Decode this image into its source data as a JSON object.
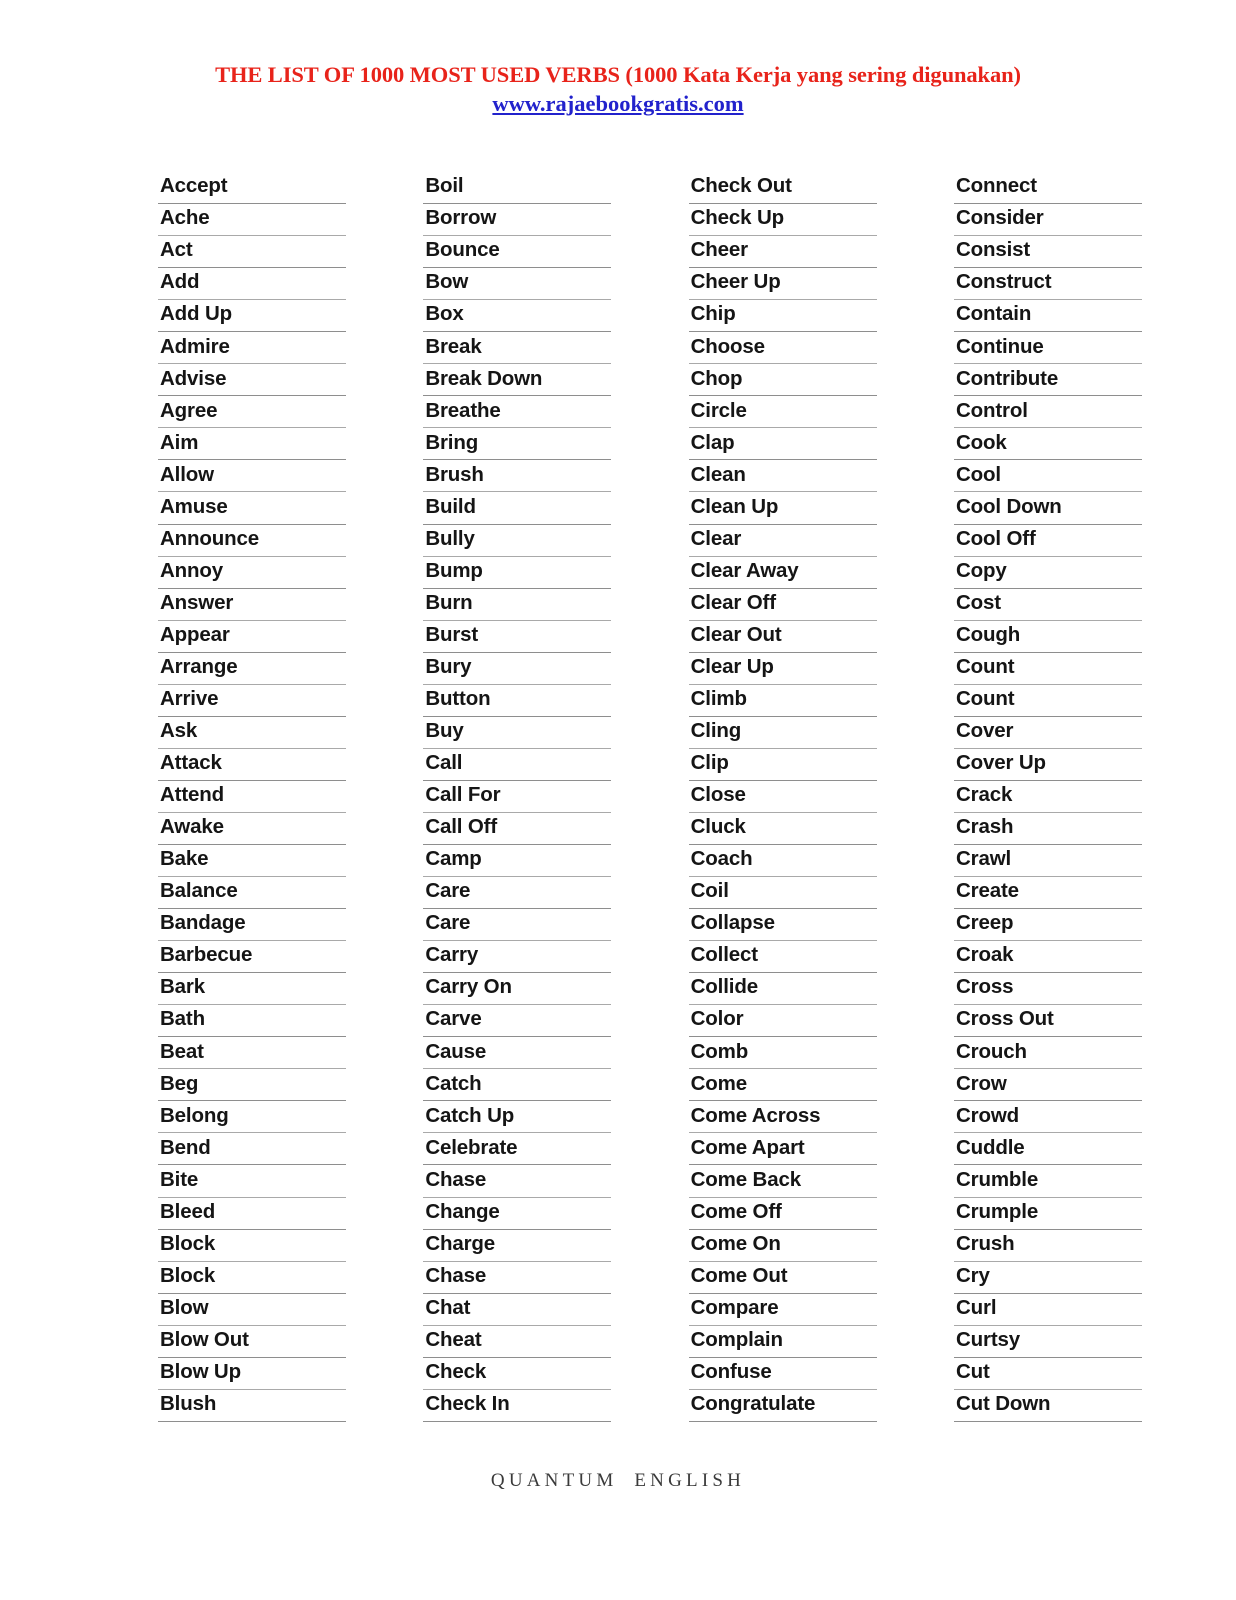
{
  "header": {
    "title": "THE LIST OF 1000 MOST USED VERBS (1000 Kata Kerja yang sering digunakan)",
    "url": "www.rajaebookgratis.com",
    "title_color": "#e8231a",
    "url_color": "#2222cc"
  },
  "footer": {
    "text": "QUANTUM ENGLISH"
  },
  "columns": [
    {
      "index": 1,
      "verbs": [
        "Accept",
        "Ache",
        "Act",
        "Add",
        "Add Up",
        "Admire",
        "Advise",
        "Agree",
        "Aim",
        "Allow",
        "Amuse",
        "Announce",
        "Annoy",
        "Answer",
        "Appear",
        "Arrange",
        "Arrive",
        "Ask",
        "Attack",
        "Attend",
        "Awake",
        "Bake",
        "Balance",
        "Bandage",
        "Barbecue",
        "Bark",
        "Bath",
        "Beat",
        "Beg",
        "Belong",
        "Bend",
        "Bite",
        "Bleed",
        "Block",
        "Block",
        "Blow",
        "Blow Out",
        "Blow Up",
        "Blush"
      ]
    },
    {
      "index": 2,
      "verbs": [
        "Boil",
        "Borrow",
        "Bounce",
        "Bow",
        "Box",
        "Break",
        "Break Down",
        "Breathe",
        "Bring",
        "Brush",
        "Build",
        "Bully",
        "Bump",
        "Burn",
        "Burst",
        "Bury",
        "Button",
        "Buy",
        "Call",
        "Call For",
        "Call Off",
        "Camp",
        "Care",
        "Care",
        "Carry",
        "Carry On",
        "Carve",
        "Cause",
        "Catch",
        "Catch Up",
        "Celebrate",
        "Chase",
        "Change",
        "Charge",
        "Chase",
        "Chat",
        "Cheat",
        "Check",
        "Check In"
      ]
    },
    {
      "index": 3,
      "verbs": [
        "Check Out",
        "Check Up",
        "Cheer",
        "Cheer Up",
        "Chip",
        "Choose",
        "Chop",
        "Circle",
        "Clap",
        "Clean",
        "Clean Up",
        "Clear",
        "Clear Away",
        "Clear Off",
        "Clear Out",
        "Clear Up",
        "Climb",
        "Cling",
        "Clip",
        "Close",
        "Cluck",
        "Coach",
        "Coil",
        "Collapse",
        "Collect",
        "Collide",
        "Color",
        "Comb",
        "Come",
        "Come Across",
        "Come Apart",
        "Come Back",
        "Come Off",
        "Come On",
        "Come Out",
        "Compare",
        "Complain",
        "Confuse",
        "Congratulate"
      ]
    },
    {
      "index": 4,
      "verbs": [
        "Connect",
        "Consider",
        "Consist",
        "Construct",
        "Contain",
        "Continue",
        "Contribute",
        "Control",
        "Cook",
        "Cool",
        "Cool Down",
        "Cool Off",
        "Copy",
        "Cost",
        "Cough",
        "Count",
        "Count",
        "Cover",
        "Cover Up",
        "Crack",
        "Crash",
        "Crawl",
        "Create",
        "Creep",
        "Croak",
        "Cross",
        "Cross Out",
        "Crouch",
        "Crow",
        "Crowd",
        "Cuddle",
        "Crumble",
        "Crumple",
        "Crush",
        "Cry",
        "Curl",
        "Curtsy",
        "Cut",
        "Cut Down"
      ]
    }
  ]
}
